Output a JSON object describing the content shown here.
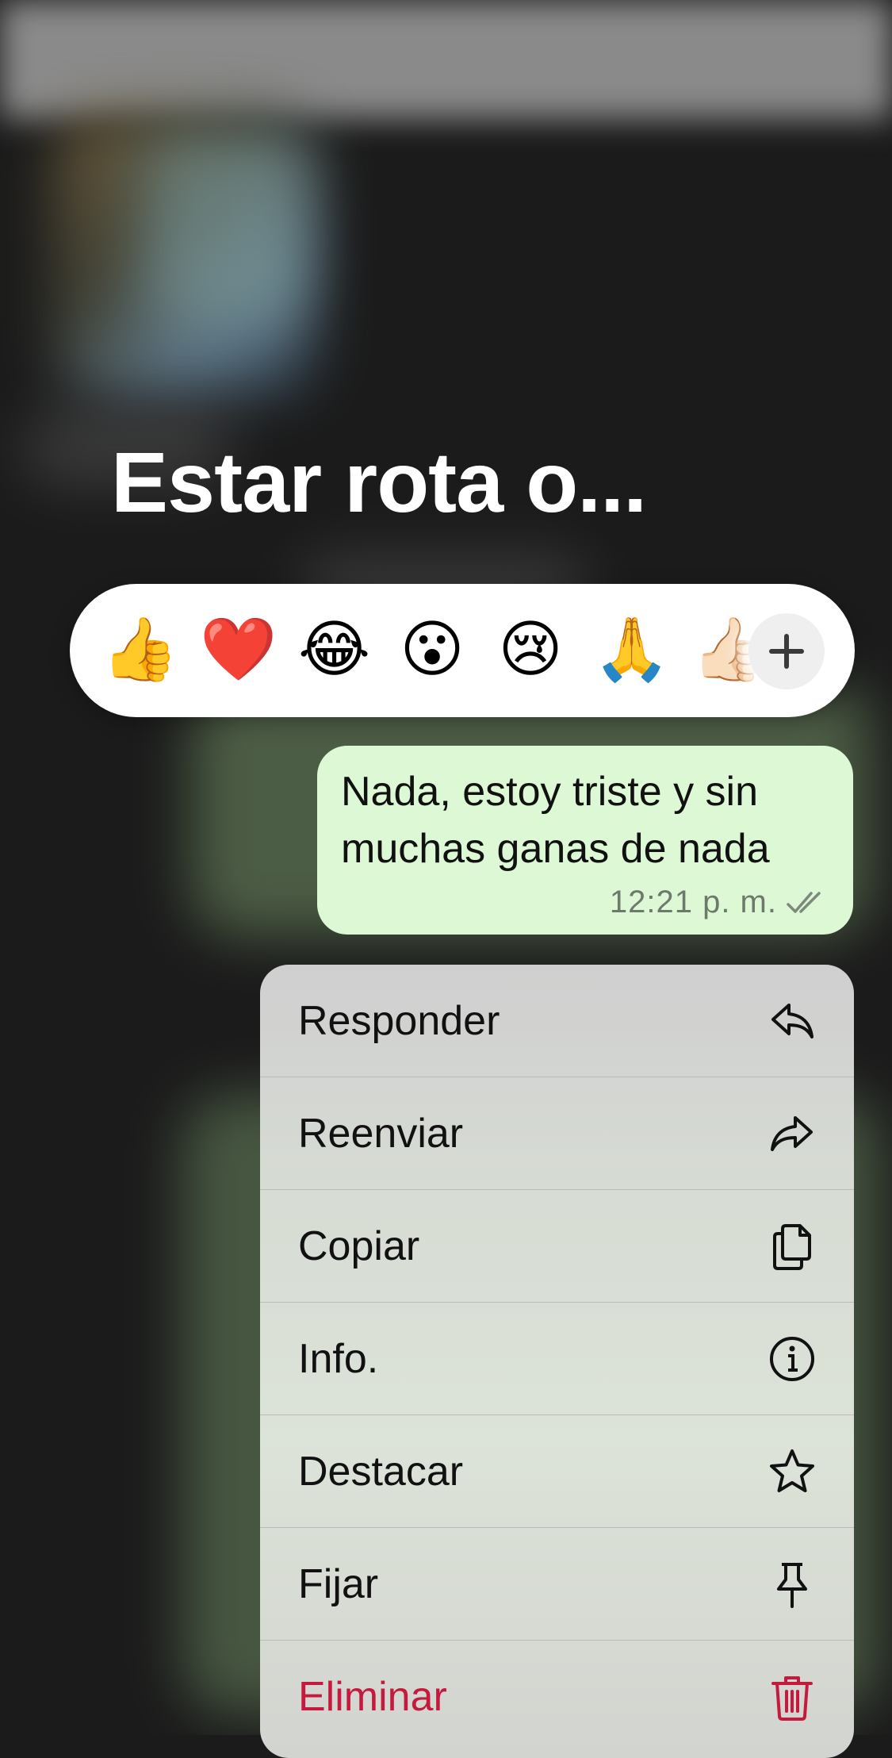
{
  "chat": {
    "title": "Estar rota o..."
  },
  "reactions": {
    "emojis": [
      "👍",
      "❤️",
      "😂",
      "😮",
      "😢",
      "🙏",
      "👍🏻"
    ],
    "more_icon": "plus-icon"
  },
  "message": {
    "text": "Nada, estoy triste y sin muchas ganas de nada",
    "time": "12:21 p. m.",
    "status_icon": "double-check-icon"
  },
  "context_menu": {
    "items": [
      {
        "label": "Responder",
        "icon": "reply-icon"
      },
      {
        "label": "Reenviar",
        "icon": "forward-icon"
      },
      {
        "label": "Copiar",
        "icon": "copy-icon"
      },
      {
        "label": "Info.",
        "icon": "info-icon"
      },
      {
        "label": "Destacar",
        "icon": "star-icon"
      },
      {
        "label": "Fijar",
        "icon": "pin-icon"
      },
      {
        "label": "Eliminar",
        "icon": "trash-icon"
      }
    ]
  },
  "colors": {
    "bubble": "#dcf8d4",
    "danger": "#c51a3d",
    "backdrop": "#1b1b1b"
  }
}
